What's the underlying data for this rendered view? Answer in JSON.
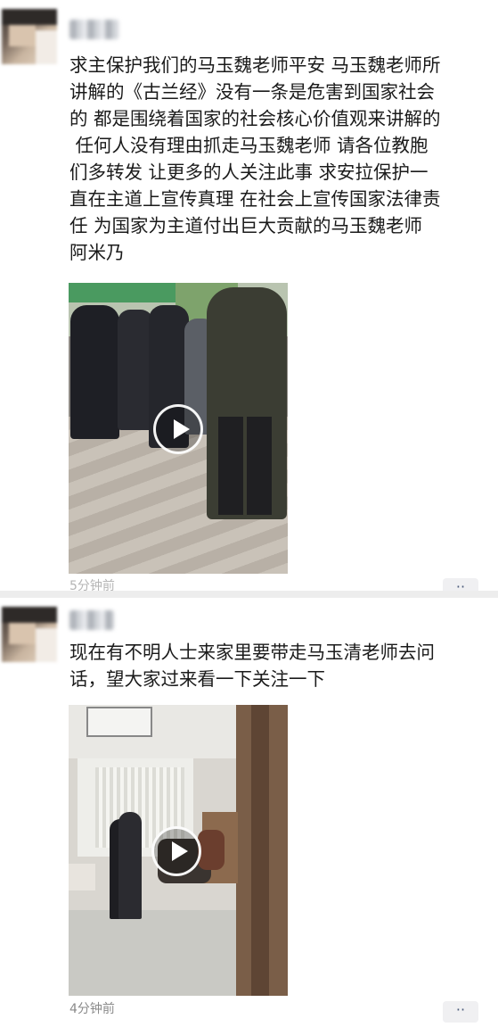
{
  "posts": [
    {
      "text": "求主保护我们的马玉魏老师平安 马玉魏老师所\n讲解的《古兰经》没有一条是危害到国家社会\n的 都是围绕着国家的社会核心价值观来讲解的\n 任何人没有理由抓走马玉魏老师 请各位教胞\n们多转发 让更多的人关注此事 求安拉保护一\n直在主道上宣传真理 在社会上宣传国家法律责\n任 为国家为主道付出巨大贡献的马玉魏老师\n阿米乃",
      "video_icon": "play-icon",
      "time": "5分钟前",
      "more_icon": "more-dots-icon"
    },
    {
      "text": "现在有不明人士来家里要带走马玉清老师去问\n话，望大家过来看一下关注一下",
      "video_icon": "play-icon",
      "time": "4分钟前",
      "more_icon": "more-dots-icon"
    }
  ],
  "colors": {
    "background": "#ffffff",
    "separator": "#ededed",
    "time": "#8a8a8a"
  }
}
